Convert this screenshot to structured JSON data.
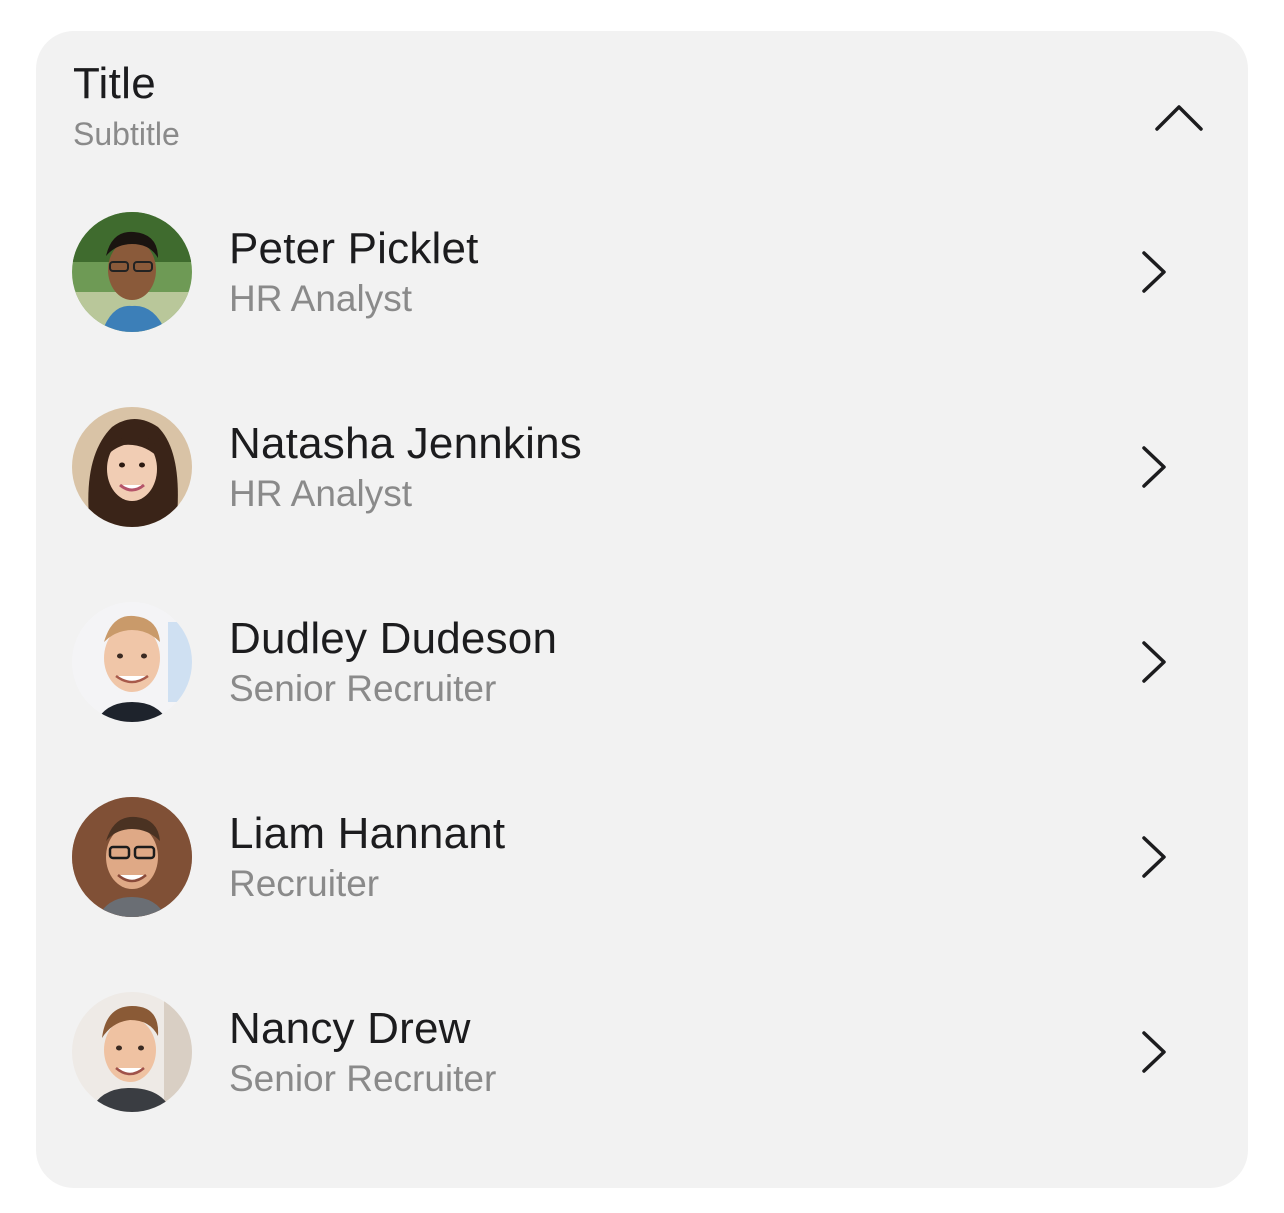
{
  "header": {
    "title": "Title",
    "subtitle": "Subtitle",
    "toggle_icon": "chevron-up-icon"
  },
  "people": [
    {
      "name": "Peter Picklet",
      "role": "HR Analyst",
      "avatar_icon": "avatar-photo",
      "action_icon": "chevron-right-icon"
    },
    {
      "name": "Natasha Jennkins",
      "role": "HR Analyst",
      "avatar_icon": "avatar-photo",
      "action_icon": "chevron-right-icon"
    },
    {
      "name": "Dudley Dudeson",
      "role": "Senior Recruiter",
      "avatar_icon": "avatar-photo",
      "action_icon": "chevron-right-icon"
    },
    {
      "name": "Liam Hannant",
      "role": "Recruiter",
      "avatar_icon": "avatar-photo",
      "action_icon": "chevron-right-icon"
    },
    {
      "name": "Nancy Drew",
      "role": "Senior Recruiter",
      "avatar_icon": "avatar-photo",
      "action_icon": "chevron-right-icon"
    }
  ],
  "colors": {
    "card_background": "#f2f2f2",
    "primary_text": "#1c1c1e",
    "secondary_text": "#8a8a8a"
  }
}
